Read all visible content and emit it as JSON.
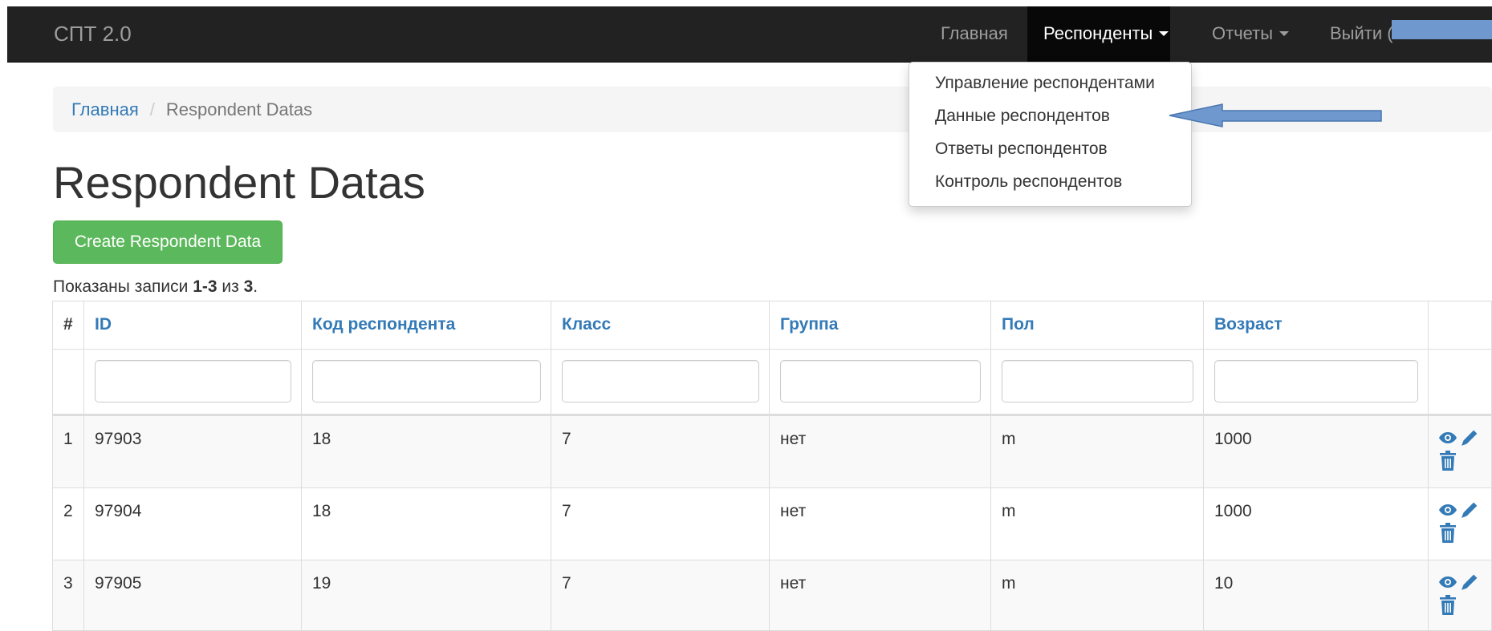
{
  "navbar": {
    "brand": "СПТ 2.0",
    "items": [
      {
        "label": "Главная"
      },
      {
        "label": "Респонденты"
      },
      {
        "label": "Отчеты"
      },
      {
        "label": "Выйти ("
      }
    ]
  },
  "dropdown": {
    "items": [
      {
        "label": "Управление респондентами"
      },
      {
        "label": "Данные респондентов"
      },
      {
        "label": "Ответы респондентов"
      },
      {
        "label": "Контроль респондентов"
      }
    ]
  },
  "breadcrumb": {
    "home": "Главная",
    "current": "Respondent Datas"
  },
  "page": {
    "title": "Respondent Datas",
    "create_button": "Create Respondent Data",
    "summary": {
      "prefix": "Показаны записи ",
      "range": "1-3",
      "middle": " из ",
      "total": "3",
      "suffix": "."
    }
  },
  "table": {
    "headers": [
      "#",
      "ID",
      "Код респондента",
      "Класс",
      "Группа",
      "Пол",
      "Возраст"
    ],
    "rows": [
      {
        "num": "1",
        "id": "97903",
        "code": "18",
        "class": "7",
        "group": "нет",
        "gender": "m",
        "age": "1000"
      },
      {
        "num": "2",
        "id": "97904",
        "code": "18",
        "class": "7",
        "group": "нет",
        "gender": "m",
        "age": "1000"
      },
      {
        "num": "3",
        "id": "97905",
        "code": "19",
        "class": "7",
        "group": "нет",
        "gender": "m",
        "age": "10"
      }
    ]
  },
  "colors": {
    "navbar_bg": "#222222",
    "link": "#337ab7",
    "success": "#5cb85c",
    "annotation_arrow": "#6f98cf",
    "border": "#dddddd"
  },
  "icons": {
    "view": "eye-icon",
    "edit": "pencil-icon",
    "delete": "trash-icon",
    "annotation": "arrow-left-icon"
  }
}
